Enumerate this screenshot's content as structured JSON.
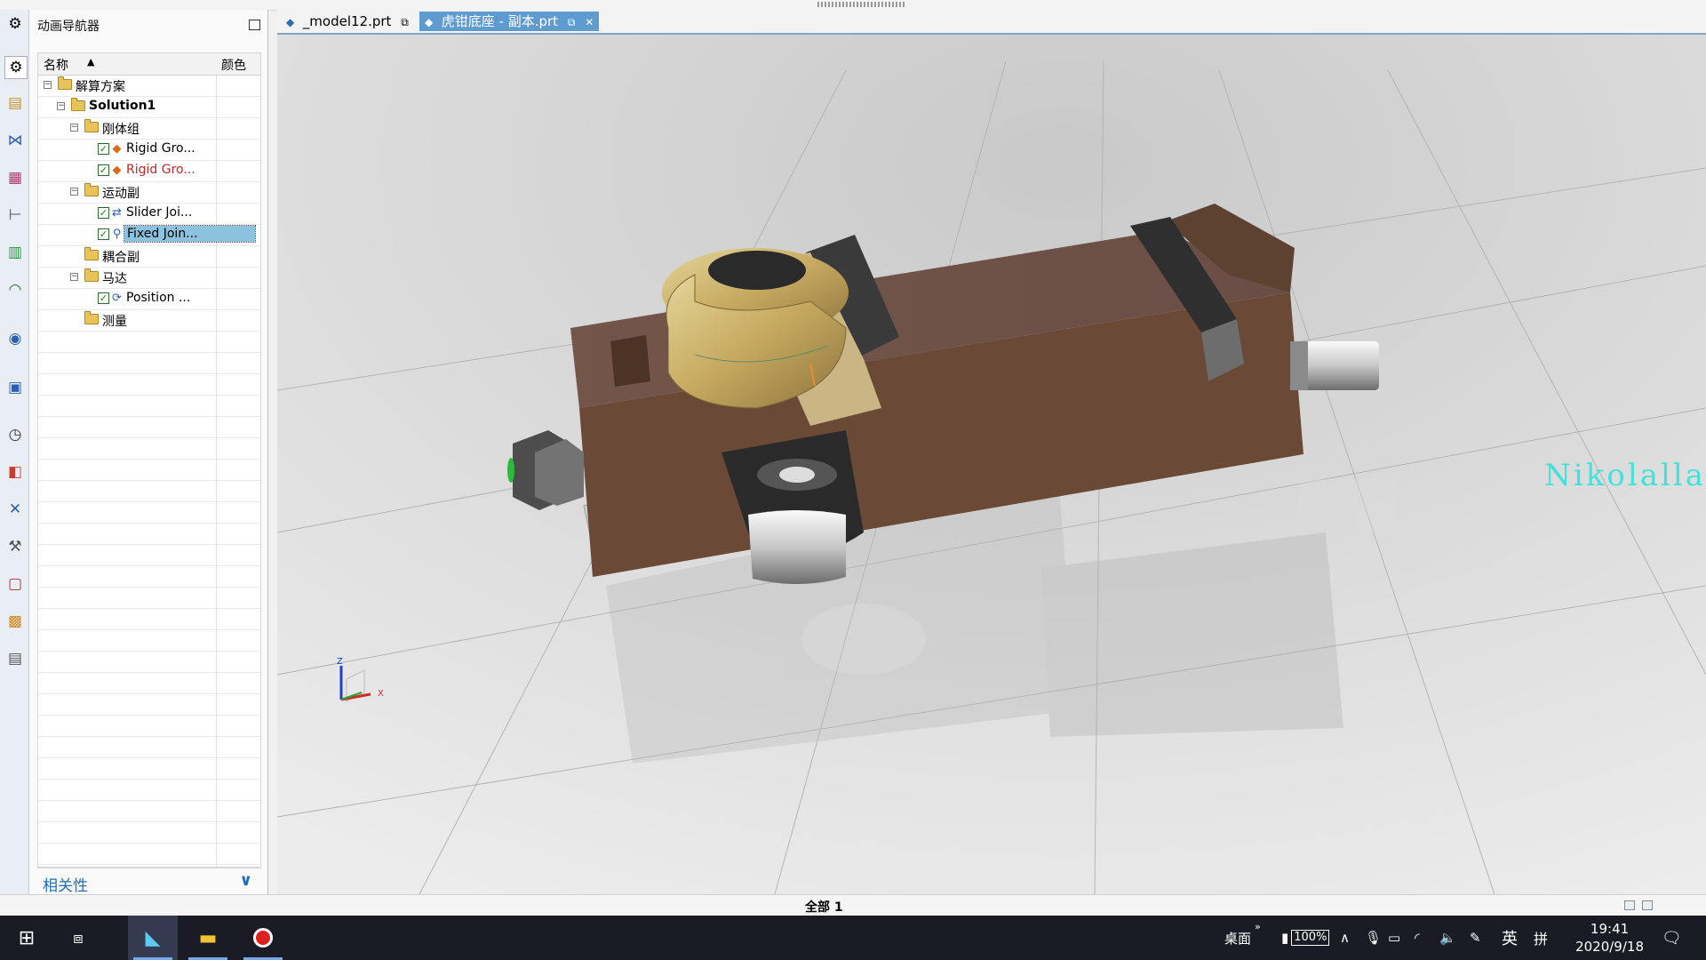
{
  "navigator": {
    "title": "动画导航器",
    "col_name": "名称",
    "col_color": "颜色",
    "rows": [
      {
        "label": "解算方案",
        "level": 0,
        "kind": "folder",
        "expand": "−"
      },
      {
        "label": "Solution1",
        "level": 1,
        "kind": "folder",
        "expand": "−",
        "bold": true
      },
      {
        "label": "刚体组",
        "level": 2,
        "kind": "folder",
        "expand": "−"
      },
      {
        "label": "Rigid Gro...",
        "level": 3,
        "kind": "item",
        "icon": "rigid-group-icon",
        "checked": true
      },
      {
        "label": "Rigid Gro...",
        "level": 3,
        "kind": "item",
        "icon": "rigid-group-icon",
        "checked": true,
        "red": true
      },
      {
        "label": "运动副",
        "level": 2,
        "kind": "folder",
        "expand": "−"
      },
      {
        "label": "Slider Joi...",
        "level": 3,
        "kind": "item",
        "icon": "slider-joint-icon",
        "checked": true
      },
      {
        "label": "Fixed Join...",
        "level": 3,
        "kind": "item",
        "icon": "fixed-joint-icon",
        "checked": true,
        "selected": true
      },
      {
        "label": "耦合副",
        "level": 2,
        "kind": "folder"
      },
      {
        "label": "马达",
        "level": 2,
        "kind": "folder",
        "expand": "−"
      },
      {
        "label": "Position ...",
        "level": 3,
        "kind": "item",
        "icon": "position-control-icon",
        "checked": true
      },
      {
        "label": "测量",
        "level": 2,
        "kind": "folder"
      }
    ],
    "relevance_label": "相关性"
  },
  "tabs": [
    {
      "label": "_model12.prt",
      "active": false
    },
    {
      "label": "虎钳底座 - 副本.prt",
      "active": true
    }
  ],
  "viewport": {
    "watermark": "Nikolalla",
    "triad": {
      "z": "Z",
      "x": "X"
    }
  },
  "status": {
    "text": "全部 1"
  },
  "taskbar": {
    "desktop_label": "桌面",
    "battery": "100%",
    "ime": "英",
    "ime2": "拼",
    "time": "19:41",
    "date": "2020/9/18"
  },
  "colors": {
    "accent": "#5d9bd1",
    "selection": "#8cc2dd",
    "red_text": "#c0282a",
    "relevance_blue": "#1d6fb8",
    "watermark": "#3fe3dc",
    "part_brown": "#6b4a35",
    "part_gold": "#c8b06e"
  }
}
